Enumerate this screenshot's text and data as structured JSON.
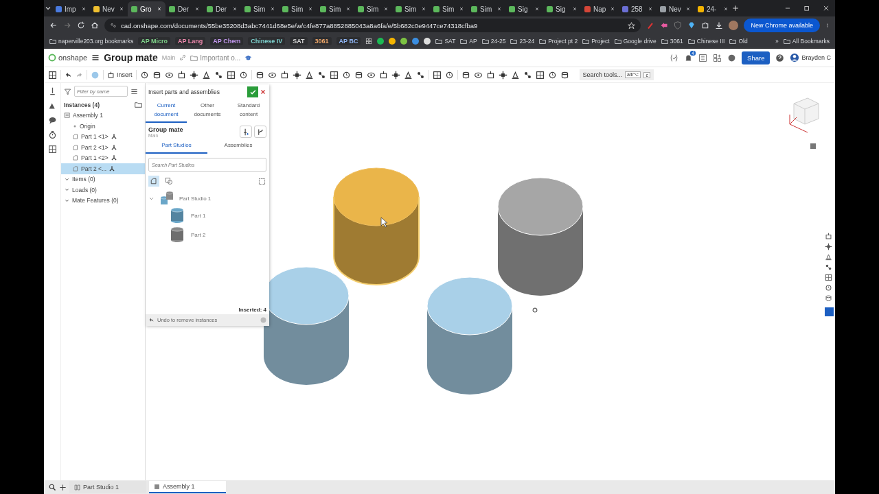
{
  "browser": {
    "tabs": [
      {
        "title": "Imp",
        "color": "#4a7be0",
        "selected": false
      },
      {
        "title": "Nev",
        "color": "#f0c030",
        "selected": false
      },
      {
        "title": "Gro",
        "color": "#5cb85c",
        "selected": true
      },
      {
        "title": "Der",
        "color": "#5cb85c",
        "selected": false
      },
      {
        "title": "Der",
        "color": "#5cb85c",
        "selected": false
      },
      {
        "title": "Sim",
        "color": "#5cb85c",
        "selected": false
      },
      {
        "title": "Sim",
        "color": "#5cb85c",
        "selected": false
      },
      {
        "title": "Sim",
        "color": "#5cb85c",
        "selected": false
      },
      {
        "title": "Sim",
        "color": "#5cb85c",
        "selected": false
      },
      {
        "title": "Sim",
        "color": "#5cb85c",
        "selected": false
      },
      {
        "title": "Sim",
        "color": "#5cb85c",
        "selected": false
      },
      {
        "title": "Sim",
        "color": "#5cb85c",
        "selected": false
      },
      {
        "title": "Sig",
        "color": "#5cb85c",
        "selected": false
      },
      {
        "title": "Sig",
        "color": "#5cb85c",
        "selected": false
      },
      {
        "title": "Nap",
        "color": "#d44638",
        "selected": false
      },
      {
        "title": "258",
        "color": "#6b6fd4",
        "selected": false
      },
      {
        "title": "Nev",
        "color": "#9aa0a6",
        "selected": false
      },
      {
        "title": "24-",
        "color": "#f4b400",
        "selected": false
      }
    ],
    "url": "cad.onshape.com/documents/55be35208d3abc7441d68e5e/w/c4fe877a8852885043a8a6fa/e/5b682c0e9447ce74318cfba9",
    "update_button": "New Chrome available",
    "bookmarks": [
      {
        "kind": "folder",
        "label": "naperville203.org bookmarks"
      },
      {
        "kind": "chip",
        "label": "AP Micro",
        "color": "#7fd38a"
      },
      {
        "kind": "chip",
        "label": "AP Lang",
        "color": "#f28bb0"
      },
      {
        "kind": "chip",
        "label": "AP Chem",
        "color": "#c59af2"
      },
      {
        "kind": "chip",
        "label": "Chinese IV",
        "color": "#7fd3d0"
      },
      {
        "kind": "chip",
        "label": "SAT",
        "color": "#d0d0d0"
      },
      {
        "kind": "chip",
        "label": "3061",
        "color": "#f2a96b"
      },
      {
        "kind": "chip",
        "label": "AP BC",
        "color": "#8fb4f2"
      },
      {
        "kind": "folder",
        "label": "SAT"
      },
      {
        "kind": "folder",
        "label": "AP"
      },
      {
        "kind": "folder",
        "label": "24-25"
      },
      {
        "kind": "folder",
        "label": "23-24"
      },
      {
        "kind": "folder",
        "label": "Project pt 2"
      },
      {
        "kind": "folder",
        "label": "Project"
      },
      {
        "kind": "folder",
        "label": "Google drive"
      },
      {
        "kind": "folder",
        "label": "3061"
      },
      {
        "kind": "folder",
        "label": "Chinese III"
      },
      {
        "kind": "folder",
        "label": "Old"
      }
    ],
    "overflow": "»",
    "all_bookmarks": "All Bookmarks"
  },
  "app": {
    "logo": "onshape",
    "document": "Group mate",
    "branch": "Main",
    "folder": "Important o...",
    "notifications": "4",
    "share": "Share",
    "user": "Brayden C",
    "insert": "Insert",
    "search_tools": "Search tools...",
    "shortcut_keys": [
      "alt/⌥",
      "c"
    ]
  },
  "feature_tree": {
    "filter_placeholder": "Filter by name",
    "instances": "Instances (4)",
    "items": [
      {
        "label": "Assembly 1",
        "selected": false,
        "children": [
          {
            "label": "Origin",
            "selected": false
          },
          {
            "label": "Part 1 <1>",
            "selected": false
          },
          {
            "label": "Part 2 <1>",
            "selected": false
          },
          {
            "label": "Part 1 <2>",
            "selected": false
          },
          {
            "label": "Part 2 <...",
            "selected": true
          }
        ]
      }
    ],
    "groups": [
      "Items (0)",
      "Loads (0)",
      "Mate Features (0)"
    ]
  },
  "insert_dialog": {
    "title": "Insert parts and assemblies",
    "tabs": [
      {
        "label": "Current document",
        "selected": true
      },
      {
        "label": "Other documents",
        "selected": false
      },
      {
        "label": "Standard content",
        "selected": false
      }
    ],
    "document": "Group mate",
    "branch": "Main",
    "subtabs": [
      {
        "label": "Part Studios",
        "selected": true
      },
      {
        "label": "Assemblies",
        "selected": false
      }
    ],
    "search_placeholder": "Search Part Studios",
    "tree": [
      {
        "label": "Part Studio 1",
        "children": [
          {
            "label": "Part 1",
            "color": "#6aa6c8"
          },
          {
            "label": "Part 2",
            "color": "#8a8a8a"
          }
        ]
      }
    ],
    "inserted": "Inserted: 4",
    "undo": "Undo to remove instances"
  },
  "viewport": {
    "parts": [
      {
        "color": "#eab54a",
        "selected": true
      },
      {
        "color": "#a6a6a6",
        "selected": false
      },
      {
        "color": "#a9d0e8",
        "selected": false
      },
      {
        "color": "#a9d0e8",
        "selected": false
      }
    ]
  },
  "bottom_tabs": [
    {
      "label": "Part Studio 1",
      "selected": false
    },
    {
      "label": "Assembly 1",
      "selected": true
    }
  ]
}
